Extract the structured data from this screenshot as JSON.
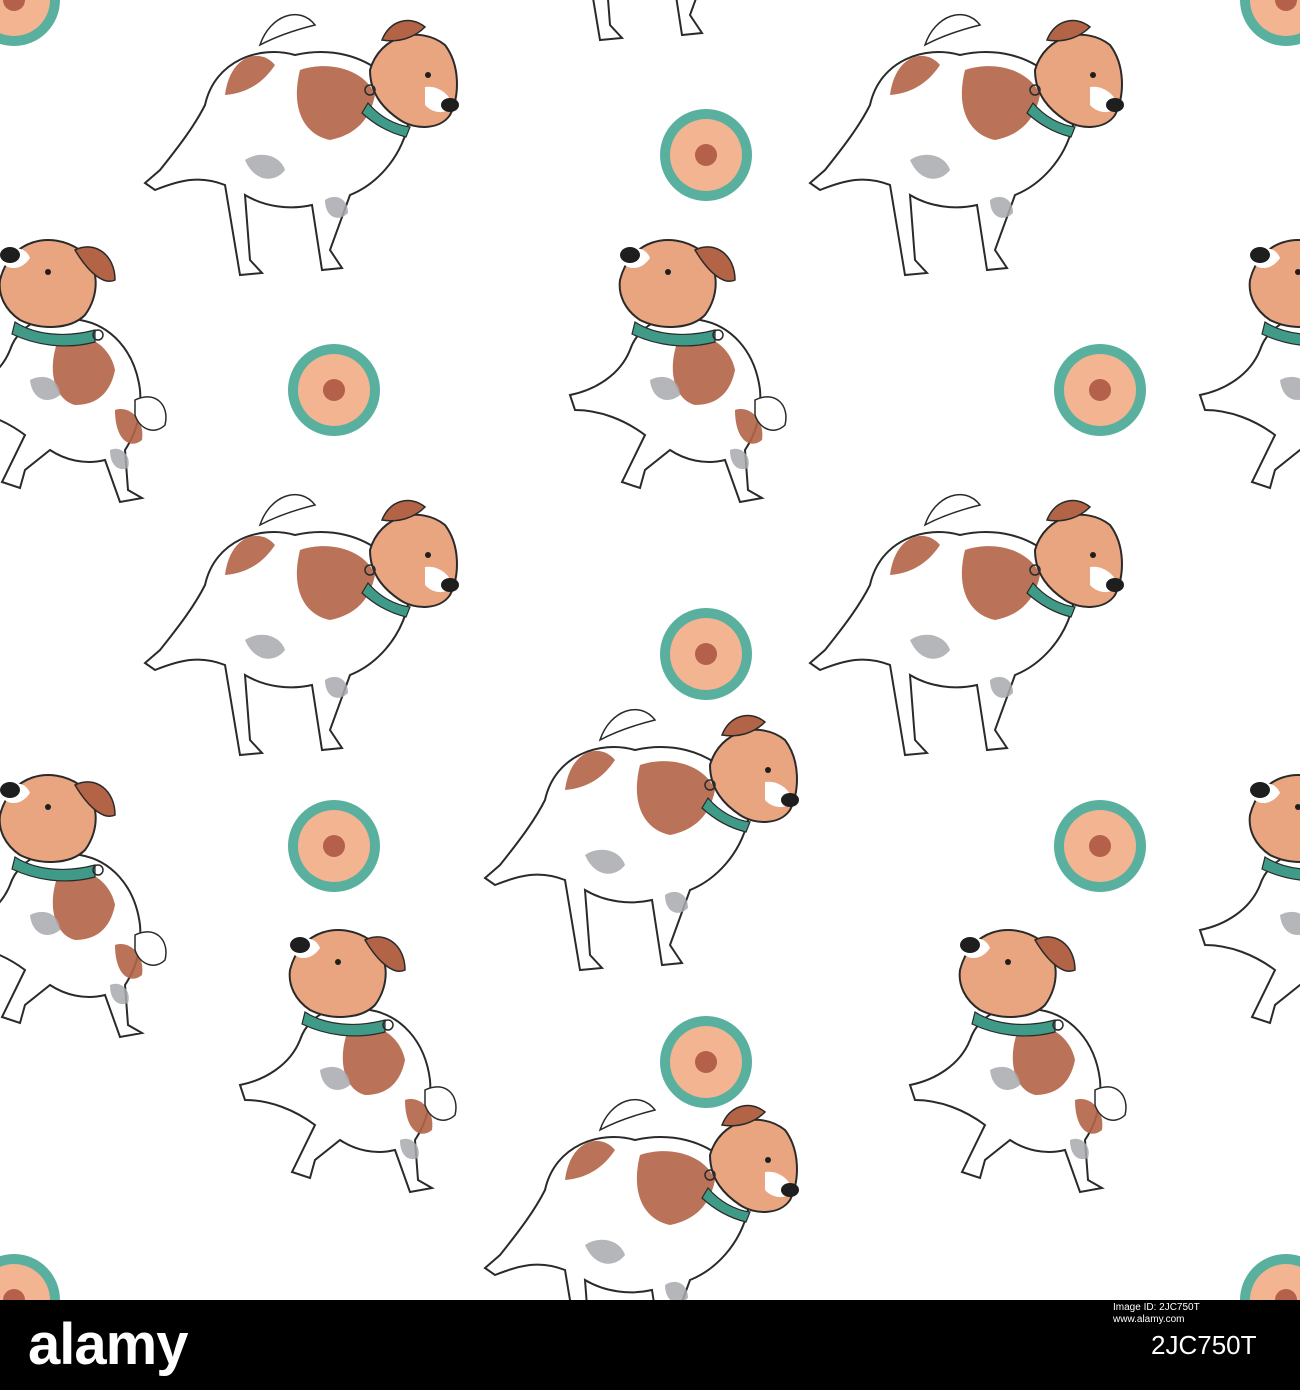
{
  "colors": {
    "background": "#ffffff",
    "fur_brown": "#b36447",
    "fur_tan": "#e8a57f",
    "fur_grey": "#a7a9ad",
    "collar": "#3f9b87",
    "ball_ring": "#59b09f",
    "ball_fill": "#f2b491",
    "ball_dot": "#b4604a",
    "ink": "#2a2a2a",
    "footer": "#000000"
  },
  "pattern": {
    "subject": "jack-russell-terrier",
    "ball": "toy-ball"
  },
  "footer": {
    "wordmark": "alamy",
    "image_id": "2JC750T",
    "side_text": [
      "Image ID: 2JC750T",
      "www.alamy.com"
    ]
  }
}
